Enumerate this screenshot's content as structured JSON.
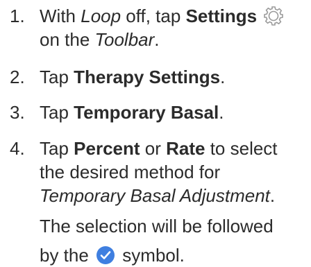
{
  "steps": [
    {
      "number": "1.",
      "line1_pre": "With ",
      "line1_loop": "Loop",
      "line1_mid": " off, tap ",
      "line1_settings": "Settings",
      "line2_pre": "on the ",
      "line2_toolbar": "Toolbar",
      "line2_end": "."
    },
    {
      "number": "2.",
      "pre": "Tap ",
      "bold": "Therapy Settings",
      "end": "."
    },
    {
      "number": "3.",
      "pre": "Tap ",
      "bold": "Temporary Basal",
      "end": "."
    },
    {
      "number": "4.",
      "line1_pre": "Tap ",
      "line1_percent": "Percent",
      "line1_or": " or ",
      "line1_rate": "Rate",
      "line1_end": " to select",
      "line2": "the desired method for",
      "line3_italic": "Temporary Basal Adjustment",
      "line3_end": ".",
      "line4": "The selection will be followed",
      "line5_pre": "by the ",
      "line5_post": " symbol."
    }
  ],
  "icons": {
    "settings": "gear-icon",
    "selection": "checkmark-circle-icon"
  },
  "colors": {
    "text": "#2b2b2b",
    "gear_outline": "#9a9a9a",
    "check_fill": "#3f7fe0"
  }
}
